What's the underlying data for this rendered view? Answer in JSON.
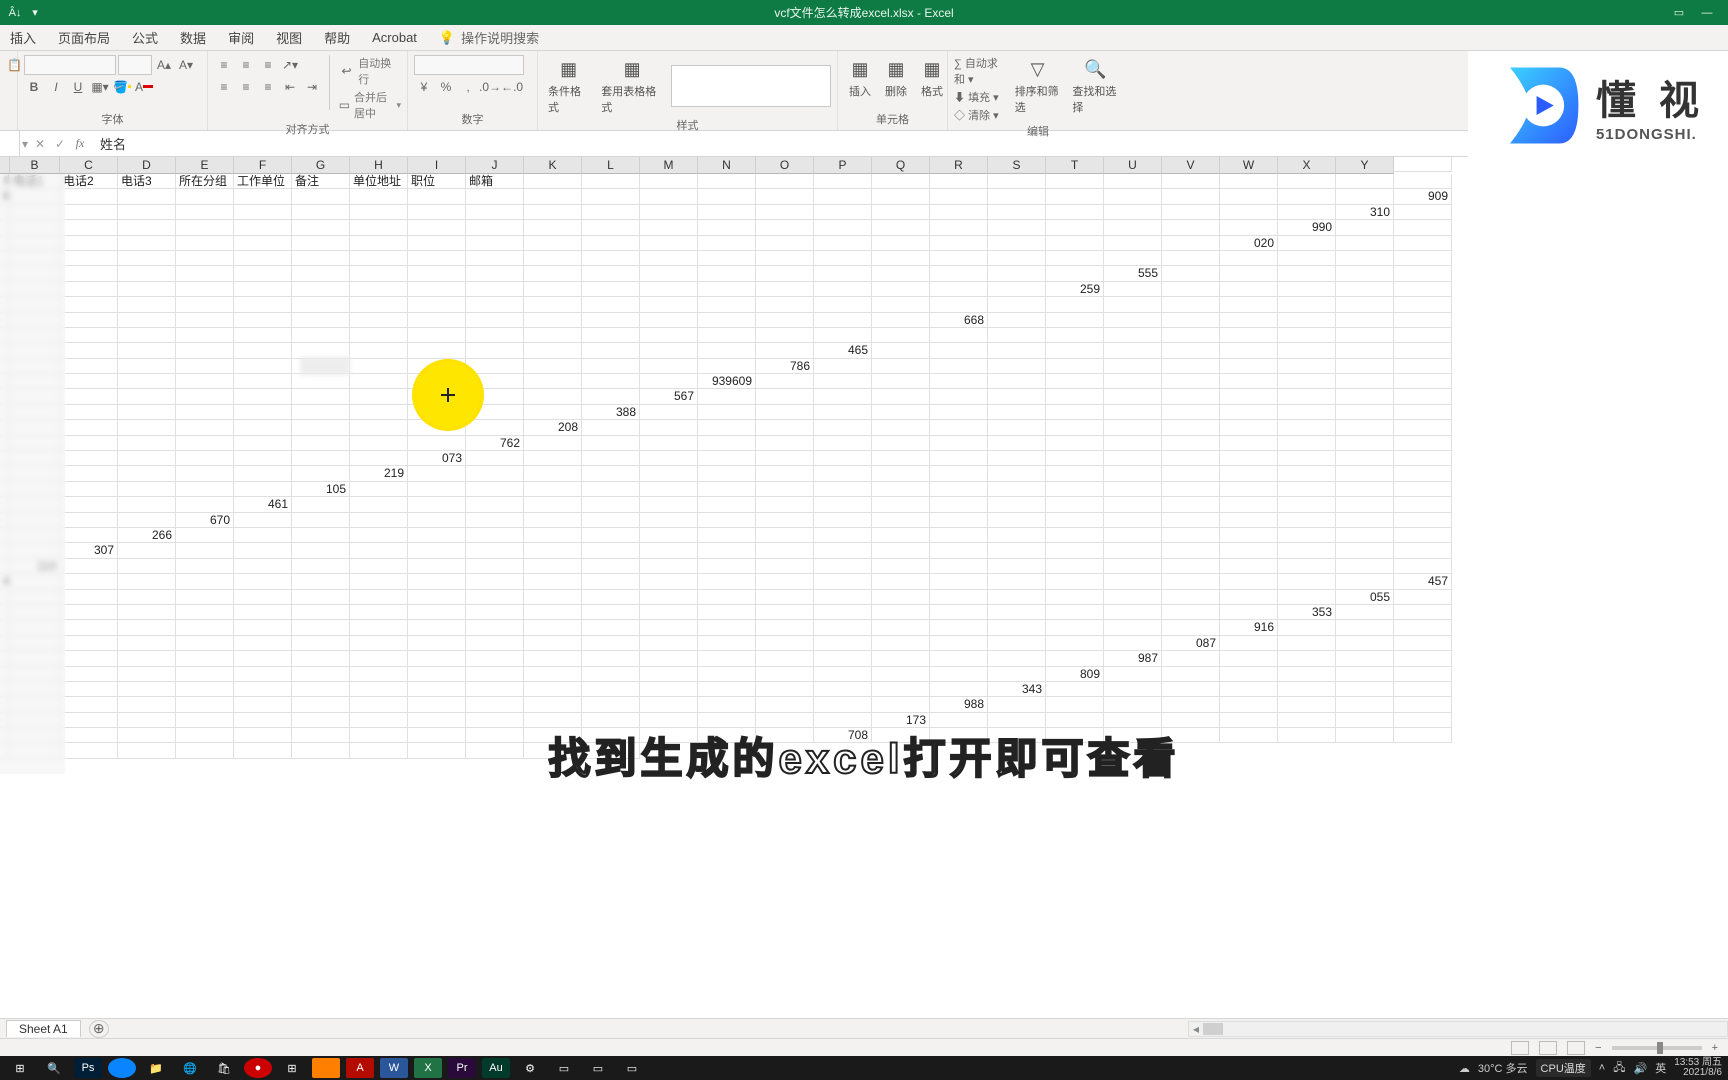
{
  "title": "vcf文件怎么转成excel.xlsx - Excel",
  "titlebar": {
    "sort_hint": "A↓"
  },
  "tabs": {
    "insert": "插入",
    "layout": "页面布局",
    "formula": "公式",
    "data": "数据",
    "review": "审阅",
    "view": "视图",
    "help": "帮助",
    "acrobat": "Acrobat",
    "search": "操作说明搜索"
  },
  "ribbon": {
    "font": {
      "label": "字体",
      "size_opts": "-",
      "bold": "B",
      "italic": "I",
      "underline": "U"
    },
    "align": {
      "label": "对齐方式",
      "wrap": "自动换行",
      "merge": "合并后居中"
    },
    "number": {
      "label": "数字",
      "currency": "¥",
      "percent": "%",
      "comma": ","
    },
    "styles": {
      "label": "样式",
      "cond": "条件格式",
      "table": "套用表格格式"
    },
    "cells": {
      "label": "单元格",
      "insert": "插入",
      "delete": "删除",
      "format": "格式"
    },
    "edit": {
      "label": "编辑",
      "autosum": "自动求和",
      "fill": "填充",
      "clear": "清除",
      "sortfilter": "排序和筛选",
      "find": "查找和选择"
    }
  },
  "watermark": {
    "cn": "懂 视",
    "en": "51DONGSHI."
  },
  "formula_bar": {
    "cell_ref": "",
    "value": "姓名"
  },
  "columns": [
    "B",
    "C",
    "D",
    "E",
    "F",
    "G",
    "H",
    "I",
    "J",
    "K",
    "L",
    "M",
    "N",
    "O",
    "P",
    "Q",
    "R",
    "S",
    "T",
    "U",
    "V",
    "W",
    "X",
    "Y"
  ],
  "header_row": {
    "B": "电话",
    "C": "电话1",
    "D": "电话2",
    "E": "电话3",
    "F": "所在分组",
    "G": "工作单位",
    "H": "备注",
    "I": "单位地址",
    "J": "职位",
    "K": "邮箱"
  },
  "rows": [
    "661",
    "909",
    "310",
    "990",
    "020",
    "",
    "555",
    "259",
    "",
    "668",
    "",
    "465",
    "786",
    "939609",
    "567",
    "388",
    "208",
    "762",
    "073",
    "219",
    "105",
    "461",
    "670",
    "266",
    "307",
    "110",
    "407",
    "457",
    "055",
    "353",
    "916",
    "087",
    "987",
    "809",
    "343",
    "988",
    "173",
    "708"
  ],
  "subtitle": "找到生成的excel打开即可查看",
  "sheet": {
    "name": "Sheet A1"
  },
  "status": {
    "zoom": "100%"
  },
  "tray": {
    "temp": "30°C 多云",
    "cpu": "CPU温度",
    "ime": "英",
    "time": "13:53 周五",
    "date": "2021/8/6"
  }
}
